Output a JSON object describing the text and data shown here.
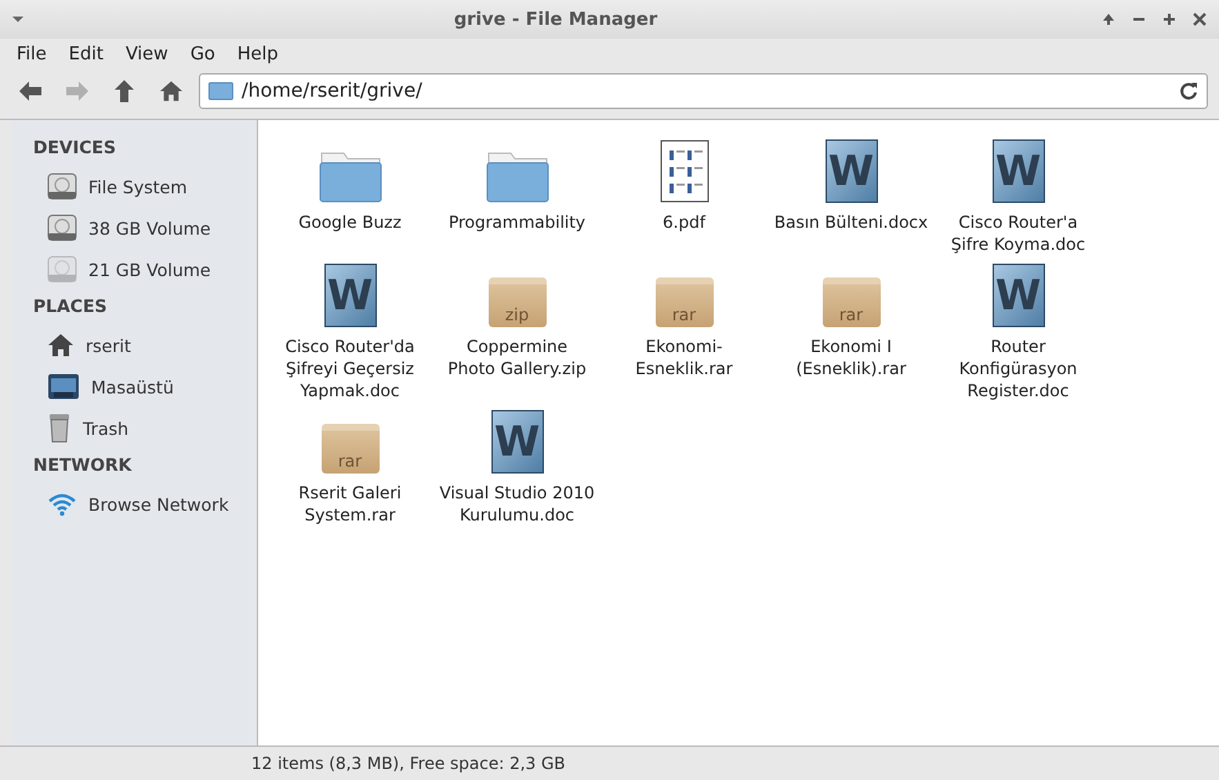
{
  "window": {
    "title": "grive - File Manager"
  },
  "menu": [
    "File",
    "Edit",
    "View",
    "Go",
    "Help"
  ],
  "toolbar": {
    "back_disabled": false,
    "forward_disabled": true,
    "path": "/home/rserit/grive/"
  },
  "sidebar": [
    {
      "heading": "DEVICES",
      "items": [
        {
          "label": "File System",
          "kind": "drive",
          "mounted": true
        },
        {
          "label": "38 GB Volume",
          "kind": "drive",
          "mounted": true
        },
        {
          "label": "21 GB Volume",
          "kind": "drive",
          "mounted": false
        }
      ]
    },
    {
      "heading": "PLACES",
      "items": [
        {
          "label": "rserit",
          "kind": "home"
        },
        {
          "label": "Masaüstü",
          "kind": "desktop"
        },
        {
          "label": "Trash",
          "kind": "trash"
        }
      ]
    },
    {
      "heading": "NETWORK",
      "items": [
        {
          "label": "Browse Network",
          "kind": "network"
        }
      ]
    }
  ],
  "files": [
    {
      "name_lines": [
        "Google Buzz"
      ],
      "kind": "folder"
    },
    {
      "name_lines": [
        "Programmability"
      ],
      "kind": "folder"
    },
    {
      "name_lines": [
        "6.pdf"
      ],
      "kind": "pdf"
    },
    {
      "name_lines": [
        "Basın Bülteni.docx"
      ],
      "kind": "word",
      "badge": "W"
    },
    {
      "name_lines": [
        "Cisco Router'a",
        "Şifre Koyma.doc"
      ],
      "kind": "word",
      "badge": "W"
    },
    {
      "name_lines": [
        "Cisco Router'da",
        "Şifreyi Geçersiz",
        "Yapmak.doc"
      ],
      "kind": "word",
      "badge": "W"
    },
    {
      "name_lines": [
        "Coppermine",
        "Photo Gallery.zip"
      ],
      "kind": "archive",
      "badge": "zip"
    },
    {
      "name_lines": [
        "Ekonomi-",
        "Esneklik.rar"
      ],
      "kind": "archive",
      "badge": "rar"
    },
    {
      "name_lines": [
        "Ekonomi I",
        "(Esneklik).rar"
      ],
      "kind": "archive",
      "badge": "rar"
    },
    {
      "name_lines": [
        "Router",
        "Konfigürasyon",
        "Register.doc"
      ],
      "kind": "word",
      "badge": "W"
    },
    {
      "name_lines": [
        "Rserit Galeri",
        "System.rar"
      ],
      "kind": "archive",
      "badge": "rar"
    },
    {
      "name_lines": [
        "Visual Studio 2010",
        "Kurulumu.doc"
      ],
      "kind": "word",
      "badge": "W"
    }
  ],
  "status_bar": "12 items (8,3 MB), Free space: 2,3 GB"
}
